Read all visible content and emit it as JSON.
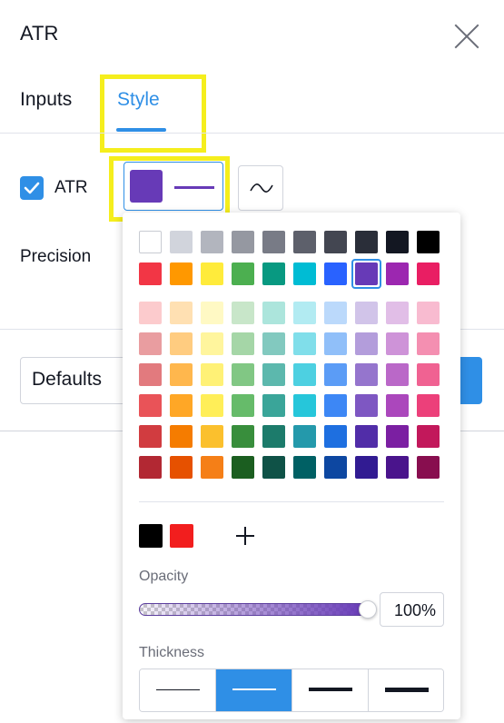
{
  "dialog": {
    "title": "ATR"
  },
  "tabs": [
    {
      "label": "Inputs"
    },
    {
      "label": "Style"
    }
  ],
  "style": {
    "plot_label": "ATR",
    "plot_checked": true,
    "plot_color": "#673ab7",
    "precision_label": "Precision"
  },
  "footer": {
    "defaults_label": "Defaults"
  },
  "color_picker": {
    "grays": [
      "#ffffff",
      "#d1d4dc",
      "#b2b5be",
      "#9598a1",
      "#787b86",
      "#5d606b",
      "#434651",
      "#2a2e39",
      "#131722",
      "#000000"
    ],
    "main": [
      "#f23645",
      "#ff9800",
      "#ffeb3b",
      "#4caf50",
      "#089981",
      "#00bcd4",
      "#2962ff",
      "#673ab7",
      "#9c27b0",
      "#e91e63"
    ],
    "shades": [
      [
        "#fccbcd",
        "#ffe0b2",
        "#fff9c4",
        "#c8e6c9",
        "#ace5dc",
        "#b2ebf2",
        "#bbd9fb",
        "#d1c4e9",
        "#e1bee7",
        "#f8bbd0"
      ],
      [
        "#e99da0",
        "#ffcc80",
        "#fff59d",
        "#a5d6a7",
        "#82c9bf",
        "#80deea",
        "#90bff9",
        "#b39ddb",
        "#ce93d8",
        "#f48fb1"
      ],
      [
        "#e27a7e",
        "#ffb74d",
        "#fff176",
        "#81c784",
        "#5cb8ad",
        "#4dd0e1",
        "#5b9cf6",
        "#9575cd",
        "#ba68c8",
        "#f06292"
      ],
      [
        "#e95358",
        "#ffa726",
        "#ffee58",
        "#66bb6a",
        "#3aa599",
        "#26c6da",
        "#3d87f5",
        "#7e57c2",
        "#ab47bc",
        "#ec407a"
      ],
      [
        "#d13c40",
        "#f57c00",
        "#fbc02d",
        "#388e3c",
        "#1c7b6b",
        "#2499ab",
        "#1e6fe0",
        "#512da8",
        "#7b1fa2",
        "#c2185b"
      ],
      [
        "#b22833",
        "#e65100",
        "#f57f17",
        "#1b5e20",
        "#0f5247",
        "#006064",
        "#0d47a1",
        "#311b92",
        "#4a148c",
        "#880e4f"
      ]
    ],
    "selected": {
      "row": "main",
      "index": 7
    },
    "custom_colors": [
      "#000000",
      "#f21e1e"
    ],
    "opacity_label": "Opacity",
    "opacity_value": "100%",
    "opacity_fraction": 1.0,
    "thickness_label": "Thickness",
    "thickness_options": [
      1,
      2,
      3,
      4
    ],
    "thickness_selected": 2
  }
}
